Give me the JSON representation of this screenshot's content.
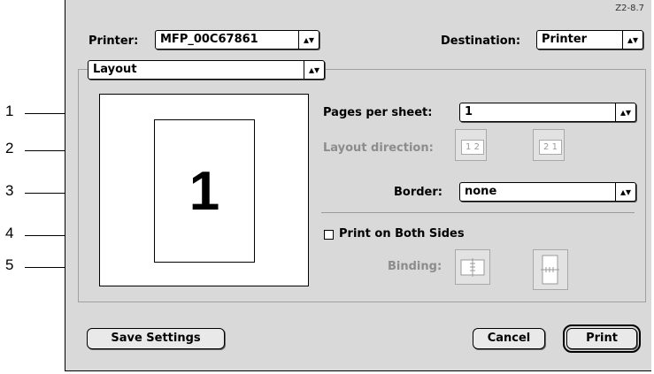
{
  "figure_id": "Z2-8.7",
  "printer": {
    "label": "Printer:",
    "value": "MFP_00C67861"
  },
  "destination": {
    "label": "Destination:",
    "value": "Printer"
  },
  "panel_menu": {
    "value": "Layout"
  },
  "preview": {
    "page_number": "1"
  },
  "pages_per_sheet": {
    "label": "Pages per sheet:",
    "value": "1"
  },
  "layout_direction": {
    "label": "Layout direction:",
    "options": [
      "1 2",
      "2 1"
    ]
  },
  "border": {
    "label": "Border:",
    "value": "none"
  },
  "print_both_sides": {
    "label": "Print on Both Sides",
    "checked": false
  },
  "binding": {
    "label": "Binding:"
  },
  "buttons": {
    "save": "Save Settings",
    "cancel": "Cancel",
    "print": "Print"
  },
  "callouts": [
    "1",
    "2",
    "3",
    "4",
    "5"
  ]
}
